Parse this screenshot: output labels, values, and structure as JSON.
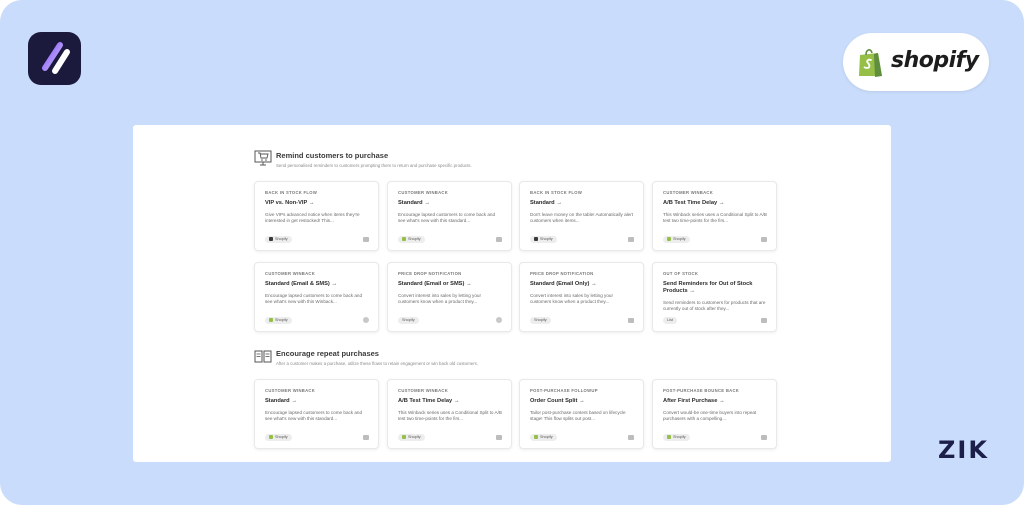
{
  "brand": {
    "app_logo_icon": "slash-logo-icon",
    "shopify_text": "shopify",
    "zik_text": "ZIK"
  },
  "sections": [
    {
      "title": "Remind customers to purchase",
      "subtitle": "Send personalised reminders to customers prompting them to return and purchase specific products.",
      "icon": "cart-icon",
      "cards": [
        {
          "category": "BACK IN STOCK FLOW",
          "title": "VIP vs. Non-VIP →",
          "desc": "Give VIPs advanced notice when items they're interested in get restocked! This...",
          "tag": "Shopify",
          "tag_color": "#3a3a3a",
          "action_icon": "email-icon"
        },
        {
          "category": "CUSTOMER WINBACK",
          "title": "Standard →",
          "desc": "Encourage lapsed customers to come back and see what's new with this standard...",
          "tag": "Shopify",
          "tag_color": "#95bf47",
          "action_icon": "email-icon"
        },
        {
          "category": "BACK IN STOCK FLOW",
          "title": "Standard →",
          "desc": "Don't leave money on the table! Automatically alert customers when items...",
          "tag": "Shopify",
          "tag_color": "#3a3a3a",
          "action_icon": "email-icon"
        },
        {
          "category": "CUSTOMER WINBACK",
          "title": "A/B Test Time Delay →",
          "desc": "This Winback series uses a Conditional Split to A/B test two time-points for the firs...",
          "tag": "Shopify",
          "tag_color": "#95bf47",
          "action_icon": "email-icon"
        },
        {
          "category": "CUSTOMER WINBACK",
          "title": "Standard (Email & SMS) →",
          "desc": "Encourage lapsed customers to come back and see what's new with this Winback...",
          "tag": "Shopify",
          "tag_color": "#95bf47",
          "action_icon": "sms-icon"
        },
        {
          "category": "PRICE DROP NOTIFICATION",
          "title": "Standard (Email or SMS) →",
          "desc": "Convert interest into sales by letting your customers know when a product they...",
          "tag": "Shopify",
          "tag_color": "",
          "action_icon": "sms-icon"
        },
        {
          "category": "PRICE DROP NOTIFICATION",
          "title": "Standard (Email Only) →",
          "desc": "Convert interest into sales by letting your customers know when a product they...",
          "tag": "Shopify",
          "tag_color": "",
          "action_icon": "email-icon"
        },
        {
          "category": "OUT OF STOCK",
          "title": "Send Reminders for Out of Stock Products →",
          "desc": "Send reminders to customers for products that are currently out of stock after they...",
          "tag": "List",
          "tag_color": "",
          "action_icon": "email-icon"
        }
      ]
    },
    {
      "title": "Encourage repeat purchases",
      "subtitle": "After a customer makes a purchase, utilize these flows to retain engagement or win back old customers.",
      "icon": "receipt-icon",
      "cards": [
        {
          "category": "CUSTOMER WINBACK",
          "title": "Standard →",
          "desc": "Encourage lapsed customers to come back and see what's new with this standard...",
          "tag": "Shopify",
          "tag_color": "#95bf47",
          "action_icon": "email-icon"
        },
        {
          "category": "CUSTOMER WINBACK",
          "title": "A/B Test Time Delay →",
          "desc": "This Winback series uses a Conditional Split to A/B test two time-points for the firs...",
          "tag": "Shopify",
          "tag_color": "#95bf47",
          "action_icon": "email-icon"
        },
        {
          "category": "POST-PURCHASE FOLLOWUP",
          "title": "Order Count Split →",
          "desc": "Tailor post-purchase content based on lifecycle stage! This flow splits out post...",
          "tag": "Shopify",
          "tag_color": "#95bf47",
          "action_icon": "email-icon"
        },
        {
          "category": "POST-PURCHASE BOUNCE BACK",
          "title": "After First Purchase →",
          "desc": "Convert would-be one-time buyers into repeat purchasers with a compelling...",
          "tag": "Shopify",
          "tag_color": "#95bf47",
          "action_icon": "email-icon"
        }
      ]
    }
  ]
}
